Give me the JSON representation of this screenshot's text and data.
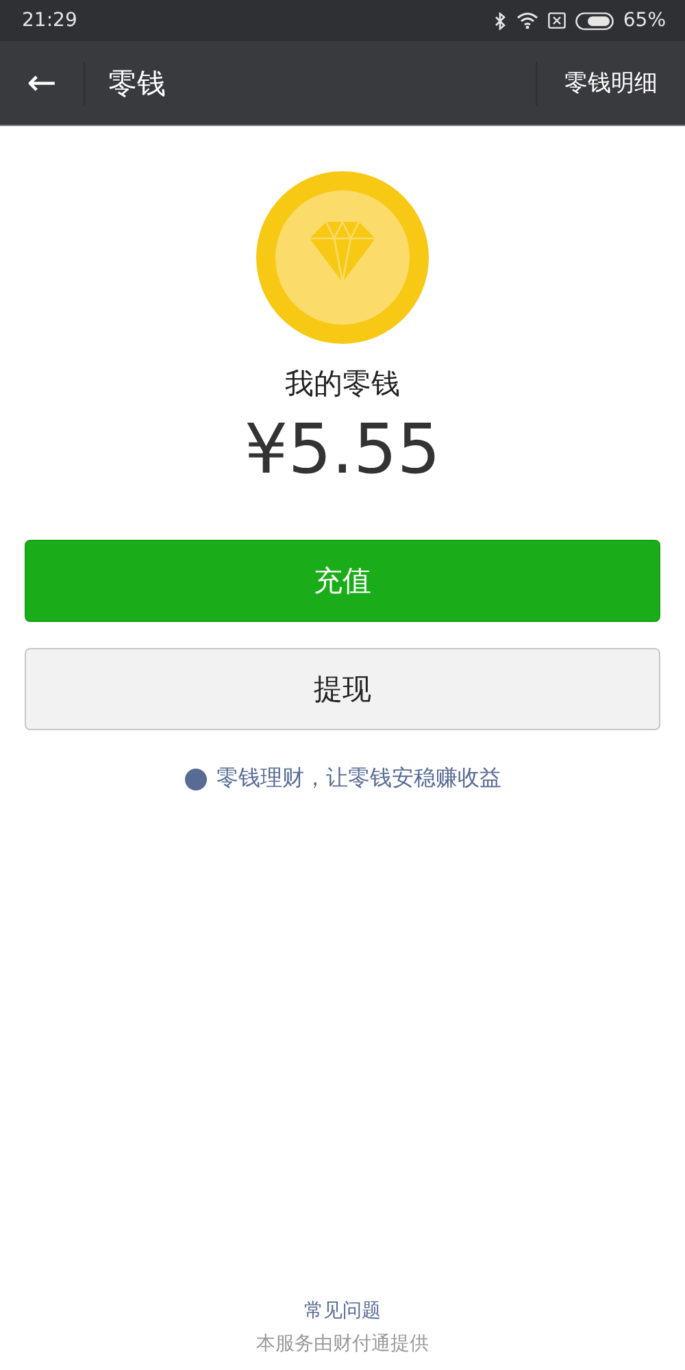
{
  "status_bar": {
    "time": "21:29",
    "battery": "65%"
  },
  "nav": {
    "back": "←",
    "title": "零钱",
    "action": "零钱明细"
  },
  "wallet": {
    "label": "我的零钱",
    "amount": "¥5.55"
  },
  "buttons": [
    {
      "label": "充值",
      "kind": "primary"
    },
    {
      "label": "提现",
      "kind": "secondary"
    }
  ],
  "promo": {
    "text": "零钱理财，让零钱安稳赚收益"
  },
  "footer": {
    "link": "常见问题",
    "note": "本服务由财付通提供"
  }
}
